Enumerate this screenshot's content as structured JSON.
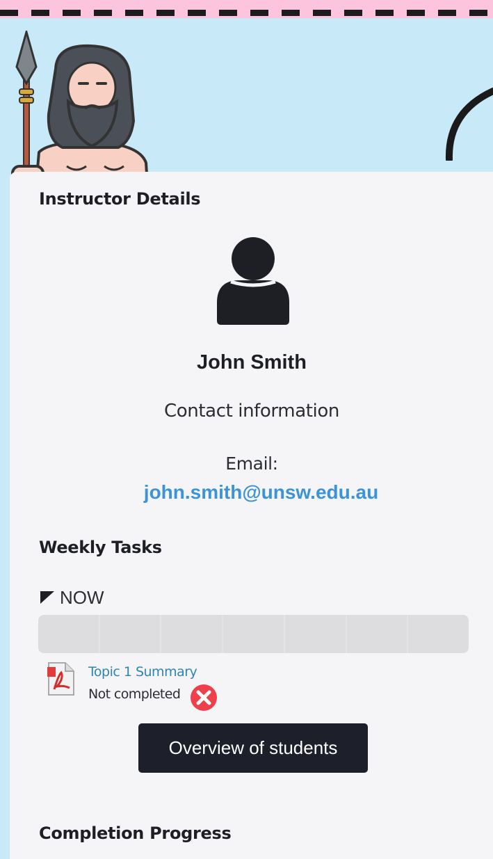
{
  "instructor": {
    "section_title": "Instructor Details",
    "name": "John Smith",
    "contact_heading": "Contact information",
    "email_label": "Email:",
    "email": "john.smith@unsw.edu.au"
  },
  "weekly_tasks": {
    "section_title": "Weekly Tasks",
    "current_week_label": "NOW",
    "progress_segments": 7,
    "progress_completed": 0,
    "tasks": [
      {
        "title": "Topic 1 Summary",
        "status": "Not completed",
        "icon": "pdf-file-icon",
        "status_icon": "not-completed-icon"
      }
    ],
    "overview_button": "Overview of students"
  },
  "completion": {
    "section_title": "Completion Progress"
  },
  "colors": {
    "banner_bg": "#c8e9f8",
    "top_border": "#fcc5dd",
    "card_bg": "#f5f5f7",
    "link": "#3c93d6",
    "button_bg": "#1d1f2a",
    "status_error": "#ee3f4a"
  }
}
